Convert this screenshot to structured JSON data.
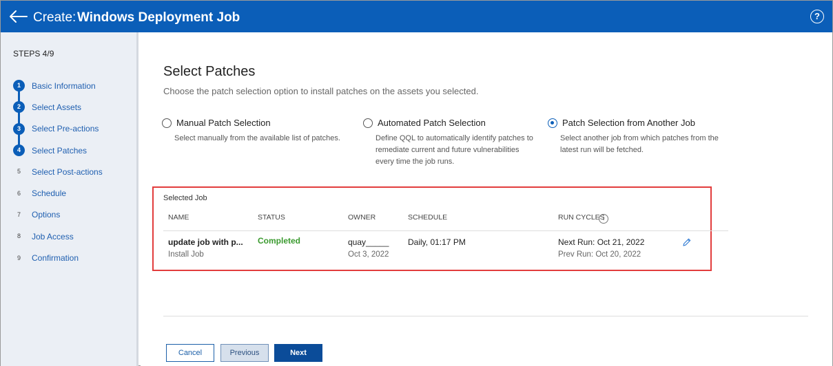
{
  "header": {
    "title_prefix": "Create:",
    "title_main": "Windows Deployment Job",
    "help_label": "?"
  },
  "sidebar": {
    "steps_label": "STEPS 4/9",
    "items": [
      {
        "num": "1",
        "label": "Basic Information"
      },
      {
        "num": "2",
        "label": "Select Assets"
      },
      {
        "num": "3",
        "label": "Select Pre-actions"
      },
      {
        "num": "4",
        "label": "Select Patches"
      },
      {
        "num": "5",
        "label": "Select Post-actions"
      },
      {
        "num": "6",
        "label": "Schedule"
      },
      {
        "num": "7",
        "label": "Options"
      },
      {
        "num": "8",
        "label": "Job Access"
      },
      {
        "num": "9",
        "label": "Confirmation"
      }
    ]
  },
  "main": {
    "heading": "Select Patches",
    "subheading": "Choose the patch selection option to install patches on the assets you selected.",
    "options": [
      {
        "title": "Manual Patch Selection",
        "desc": "Select manually from the available list of patches.",
        "selected": false
      },
      {
        "title": "Automated Patch Selection",
        "desc_lines": [
          "Define QQL to automatically identify patches to",
          "remediate current and future vulnerabilities",
          "every time the job runs."
        ],
        "selected": false
      },
      {
        "title": "Patch Selection from Another Job",
        "desc_lines": [
          "Select another job from which patches from the",
          "latest run will be fetched."
        ],
        "selected": true
      }
    ],
    "selected_job": {
      "label": "Selected Job",
      "columns": [
        "NAME",
        "STATUS",
        "OWNER",
        "SCHEDULE",
        "RUN CYCLES"
      ],
      "row": {
        "name": "update job with p...",
        "type": "Install Job",
        "status": "Completed",
        "owner": "quay_____",
        "owner_date": "Oct 3, 2022",
        "schedule": "Daily, 01:17 PM",
        "next_run": "Next Run: Oct 21, 2022",
        "prev_run": "Prev Run: Oct 20, 2022"
      }
    }
  },
  "footer": {
    "cancel": "Cancel",
    "previous": "Previous",
    "next": "Next"
  },
  "colors": {
    "header_bg": "#0b5eb8",
    "status_completed": "#3a9a2e",
    "highlight_border": "#e23c3c"
  },
  "icons": {
    "back": "arrow-left-icon",
    "help": "help-circle-icon",
    "info": "info-icon",
    "edit": "pencil-icon"
  }
}
